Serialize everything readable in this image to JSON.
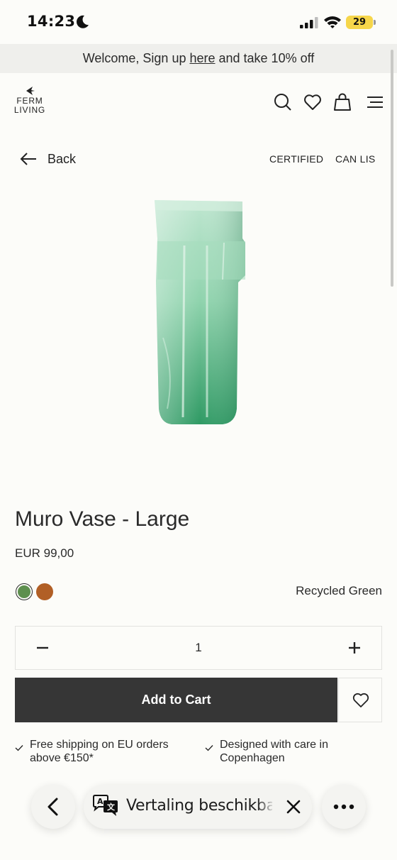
{
  "status_bar": {
    "time": "14:23",
    "battery": "29"
  },
  "promo": {
    "prefix": "Welcome, Sign up ",
    "link": "here",
    "suffix": " and take 10% off"
  },
  "header": {
    "logo_line1": "FERM",
    "logo_line2": "LIVING"
  },
  "nav": {
    "back_label": "Back",
    "tags": [
      "CERTIFIED",
      "CAN LIS"
    ]
  },
  "product": {
    "title": "Muro Vase - Large",
    "price": "EUR 99,00",
    "selected_color": "Recycled Green",
    "swatches": [
      "#5d8f4e",
      "#b15f26"
    ],
    "quantity": "1",
    "add_to_cart": "Add to Cart"
  },
  "usp": [
    "Free shipping on EU orders above €150*",
    "Designed with care in Copenhagen"
  ],
  "browser_bar": {
    "translate_label": "Vertaling beschikbaar"
  },
  "colors": {
    "cart_button": "#363636",
    "background": "#fcfcf9",
    "glass": "#6fc39a"
  }
}
